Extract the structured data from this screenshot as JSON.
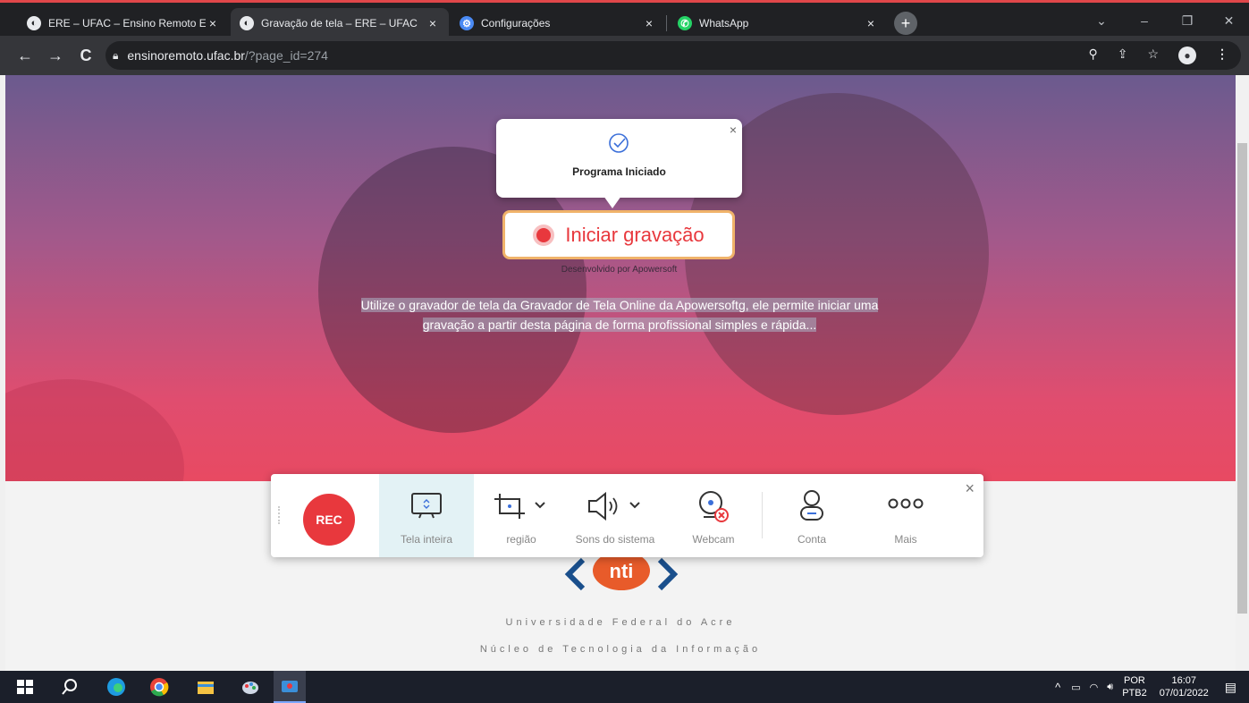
{
  "browser": {
    "tabs": [
      {
        "title": "ERE – UFAC – Ensino Remoto Em",
        "active": false,
        "icon": "globe-icon"
      },
      {
        "title": "Gravação de tela – ERE – UFAC",
        "active": true,
        "icon": "globe-icon"
      },
      {
        "title": "Configurações",
        "active": false,
        "icon": "gear-icon"
      },
      {
        "title": "WhatsApp",
        "active": false,
        "icon": "whatsapp-icon"
      }
    ],
    "tab_close": "×",
    "new_tab": "+",
    "url_host": "ensinoremoto.ufac.br",
    "url_path": "/?page_id=274"
  },
  "popup": {
    "title": "Programa Iniciado",
    "close": "×"
  },
  "start_button": {
    "label": "Iniciar gravação"
  },
  "developed_by": "Desenvolvido por Apowersoft",
  "description": {
    "line1": "Utilize o gravador de tela da Gravador de Tela Online da Apowersoftg, ele permite iniciar uma",
    "line2": "gravação a partir desta página de forma profissional simples e rápida..."
  },
  "footer": {
    "logo_text": "nti",
    "line1": "Universidade Federal do Acre",
    "line2": "Núcleo de Tecnologia da Informação"
  },
  "recorder": {
    "rec_label": "REC",
    "items": [
      {
        "label": "Tela inteira",
        "icon": "fullscreen-icon",
        "selected": true
      },
      {
        "label": "região",
        "icon": "crop-icon",
        "selected": false
      },
      {
        "label": "Sons do sistema",
        "icon": "speaker-icon",
        "selected": false
      },
      {
        "label": "Webcam",
        "icon": "webcam-icon",
        "selected": false
      },
      {
        "label": "Conta",
        "icon": "user-icon",
        "selected": false
      },
      {
        "label": "Mais",
        "icon": "more-icon",
        "selected": false
      }
    ],
    "close": "×"
  },
  "taskbar": {
    "lang1": "POR",
    "lang2": "PTB2",
    "time": "16:07",
    "date": "07/01/2022"
  },
  "colors": {
    "accent_red": "#e8383d",
    "hero_top": "#6b5a8e",
    "hero_bottom": "#e84a62",
    "start_border": "#f0b36a"
  }
}
